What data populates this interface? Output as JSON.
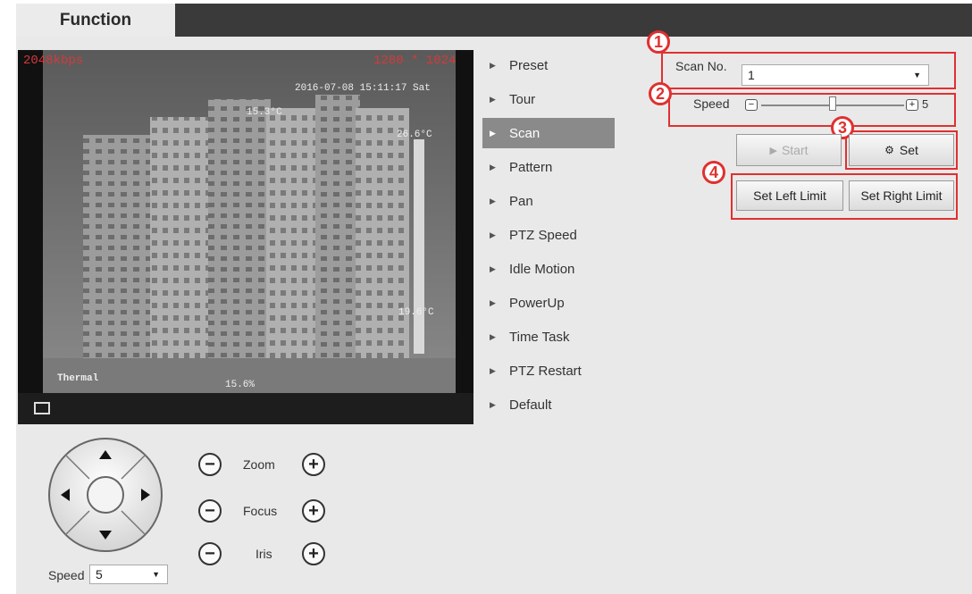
{
  "tabs": {
    "active": "Function"
  },
  "video": {
    "osd_top_left": "2048kbps",
    "osd_top_right": "1280 * 1024",
    "datetime": "2016-07-08 15:11:17 Sat",
    "temp_top": "15.3°C",
    "temp_right_top": "26.6°C",
    "temp_right_mid": "19.6°C",
    "temp_bottom": "15.6%",
    "channel_label": "Thermal"
  },
  "menu": {
    "items": [
      {
        "label": "Preset"
      },
      {
        "label": "Tour"
      },
      {
        "label": "Scan",
        "active": true
      },
      {
        "label": "Pattern"
      },
      {
        "label": "Pan"
      },
      {
        "label": "PTZ Speed"
      },
      {
        "label": "Idle Motion"
      },
      {
        "label": "PowerUp"
      },
      {
        "label": "Time Task"
      },
      {
        "label": "PTZ Restart"
      },
      {
        "label": "Default"
      }
    ]
  },
  "scan": {
    "scan_no_label": "Scan No.",
    "scan_no_value": "1",
    "speed_label": "Speed",
    "speed_value": "5",
    "speed_level": 0.5,
    "start_label": "Start",
    "set_label": "Set",
    "set_left_limit_label": "Set Left Limit",
    "set_right_limit_label": "Set Right Limit",
    "callouts": [
      "1",
      "2",
      "3",
      "4"
    ]
  },
  "ptz": {
    "zoom_label": "Zoom",
    "focus_label": "Focus",
    "iris_label": "Iris",
    "speed_label": "Speed",
    "speed_value": "5"
  },
  "colors": {
    "callout": "#e03030",
    "active_menu": "#8a8a8a",
    "tabbar": "#3a3a3a"
  }
}
